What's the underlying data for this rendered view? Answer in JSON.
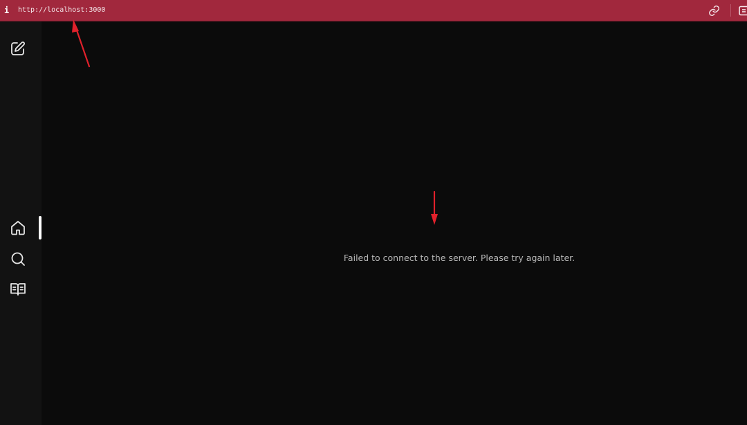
{
  "address_bar": {
    "url": "http://localhost:3000",
    "info_icon": "info-icon",
    "link_icon": "link-icon",
    "corner_icon": "panel-icon",
    "background": "#a1283d"
  },
  "sidebar": {
    "items": [
      {
        "name": "new-note",
        "icon": "edit-icon"
      },
      {
        "name": "home",
        "icon": "home-icon",
        "active": true
      },
      {
        "name": "search",
        "icon": "search-icon"
      },
      {
        "name": "library",
        "icon": "book-icon"
      }
    ]
  },
  "main": {
    "error_message": "Failed to connect to the server. Please try again later."
  },
  "annotations": {
    "arrow_color": "#e0212b"
  }
}
